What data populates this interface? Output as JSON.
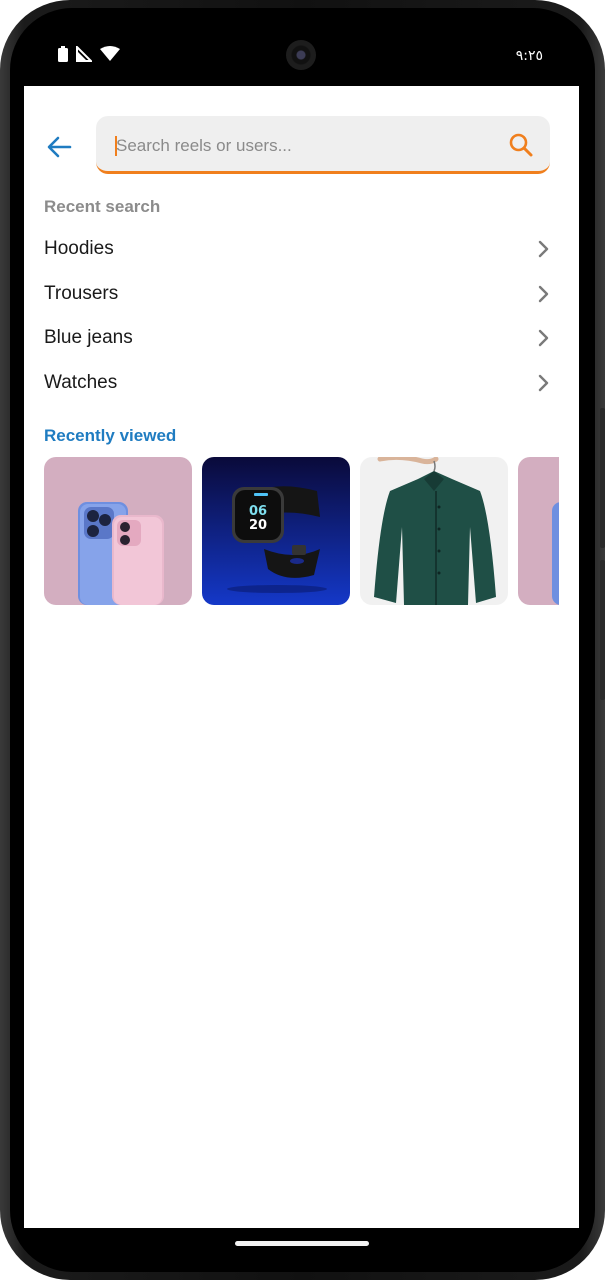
{
  "status_bar": {
    "time": "٩:٢٥",
    "icons": [
      "battery-icon",
      "signal-icon",
      "wifi-icon"
    ]
  },
  "search": {
    "placeholder": "Search reels or users...",
    "value": ""
  },
  "recent_search": {
    "title": "Recent search",
    "items": [
      {
        "label": "Hoodies"
      },
      {
        "label": "Trousers"
      },
      {
        "label": "Blue jeans"
      },
      {
        "label": "Watches"
      }
    ]
  },
  "recently_viewed": {
    "title": "Recently viewed",
    "items": [
      {
        "image": "phones-image"
      },
      {
        "image": "smartwatch-image"
      },
      {
        "image": "green-shirt-image"
      },
      {
        "image": "phones-image"
      }
    ]
  },
  "colors": {
    "accent": "#f07f1d",
    "link_blue": "#1f7cc1",
    "muted_text": "#8c8c8c",
    "search_bg": "#efefef"
  }
}
